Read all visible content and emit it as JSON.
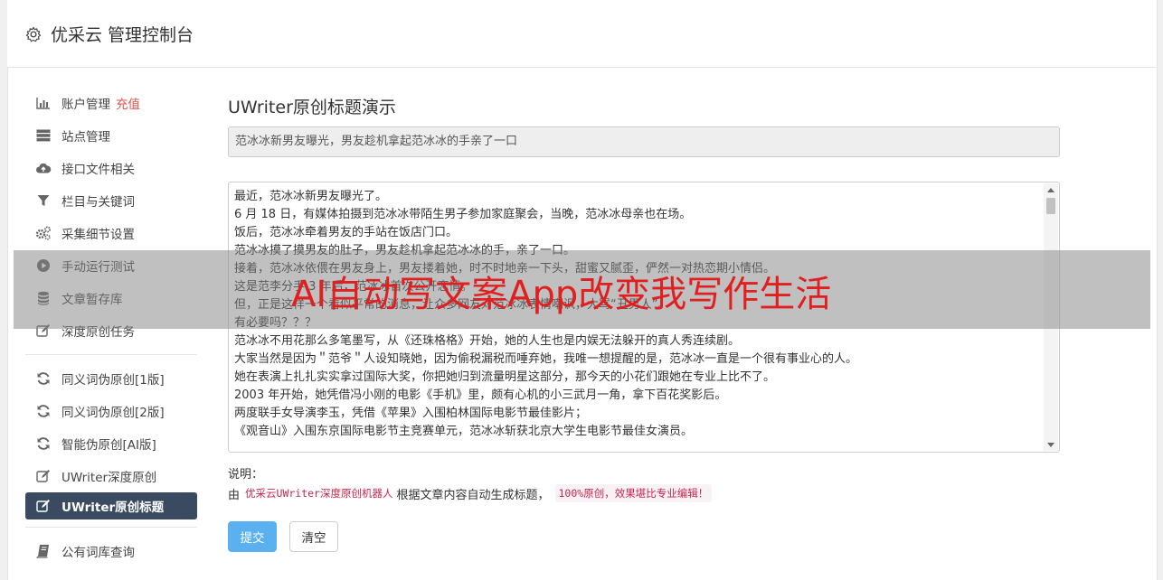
{
  "header": {
    "title": "优采云 管理控制台",
    "icon": "gear-icon"
  },
  "sidebar": {
    "group1": [
      {
        "label": "账户管理",
        "badge": "充值",
        "icon": "bar-chart-icon"
      },
      {
        "label": "站点管理",
        "icon": "server-icon"
      },
      {
        "label": "接口文件相关",
        "icon": "cloud-upload-icon"
      },
      {
        "label": "栏目与关键词",
        "icon": "filter-icon"
      },
      {
        "label": "采集细节设置",
        "icon": "cogs-icon"
      },
      {
        "label": "手动运行测试",
        "icon": "play-circle-icon"
      },
      {
        "label": "文章暂存库",
        "icon": "database-icon"
      },
      {
        "label": "深度原创任务",
        "icon": "edit-icon"
      }
    ],
    "group2": [
      {
        "label": "同义词伪原创[1版]",
        "icon": "refresh-icon"
      },
      {
        "label": "同义词伪原创[2版]",
        "icon": "refresh-icon"
      },
      {
        "label": "智能伪原创[AI版]",
        "icon": "refresh-icon"
      },
      {
        "label": "UWriter深度原创",
        "icon": "edit-icon"
      },
      {
        "label": "UWriter原创标题",
        "icon": "edit-icon",
        "active": true
      }
    ],
    "group3": [
      {
        "label": "公有词库查询",
        "icon": "book-icon"
      }
    ]
  },
  "main": {
    "title": "UWriter原创标题演示",
    "generated_title": "范冰冰新男友曝光，男友趁机拿起范冰冰的手亲了一口",
    "article_lines": [
      "最近，范冰冰新男友曝光了。",
      "6 月 18 日，有媒体拍摄到范冰冰带陌生男子参加家庭聚会，当晚，范冰冰母亲也在场。",
      "饭后，范冰冰牵着男友的手站在饭店门口。",
      "范冰冰摸了摸男友的肚子，男友趁机拿起范冰冰的手，亲了一口。",
      "接着，范冰冰依偎在男友身上，男友搂着她，时不时地亲一下头，甜蜜又腻歪，俨然一对热恋期小情侣。",
      "这是范李分手 3 年后，范冰冰首次公开恋情。",
      "但，正是这样一个看似平常的消息，让众多网友对范冰冰表情嘲讽，大骂“丑男人”。",
      "有必要吗？？？",
      "范冰冰不用花那么多笔墨写，从《还珠格格》开始，她的人生也是内娱无法躲开的真人秀连续剧。",
      "大家当然是因为＂范爷＂人设知晓她，因为偷税漏税而唾弃她，我唯一想提醒的是，范冰冰一直是一个很有事业心的人。",
      "她在表演上扎扎实实拿过国际大奖，你把她归到流量明星这部分，那今天的小花们跟她在专业上比不了。",
      "2003 年开始，她凭借冯小刚的电影《手机》里，颇有心机的小三武月一角，拿下百花奖影后。",
      "两度联手女导演李玉，凭借《苹果》入围柏林国际电影节最佳影片；",
      "《观音山》入围东京国际电影节主竞赛单元，范冰冰斩获北京大学生电影节最佳女演员。"
    ],
    "note_label": "说明：",
    "note_prefix": "由",
    "note_code1": "优采云UWriter深度原创机器人",
    "note_mid": "根据文章内容自动生成标题，",
    "note_code2": "100%原创，效果堪比专业编辑！",
    "submit_label": "提交",
    "clear_label": "清空"
  },
  "overlay": {
    "watermark_text": "AI自动写文案App改变我写作生活",
    "color": "#e02020"
  }
}
